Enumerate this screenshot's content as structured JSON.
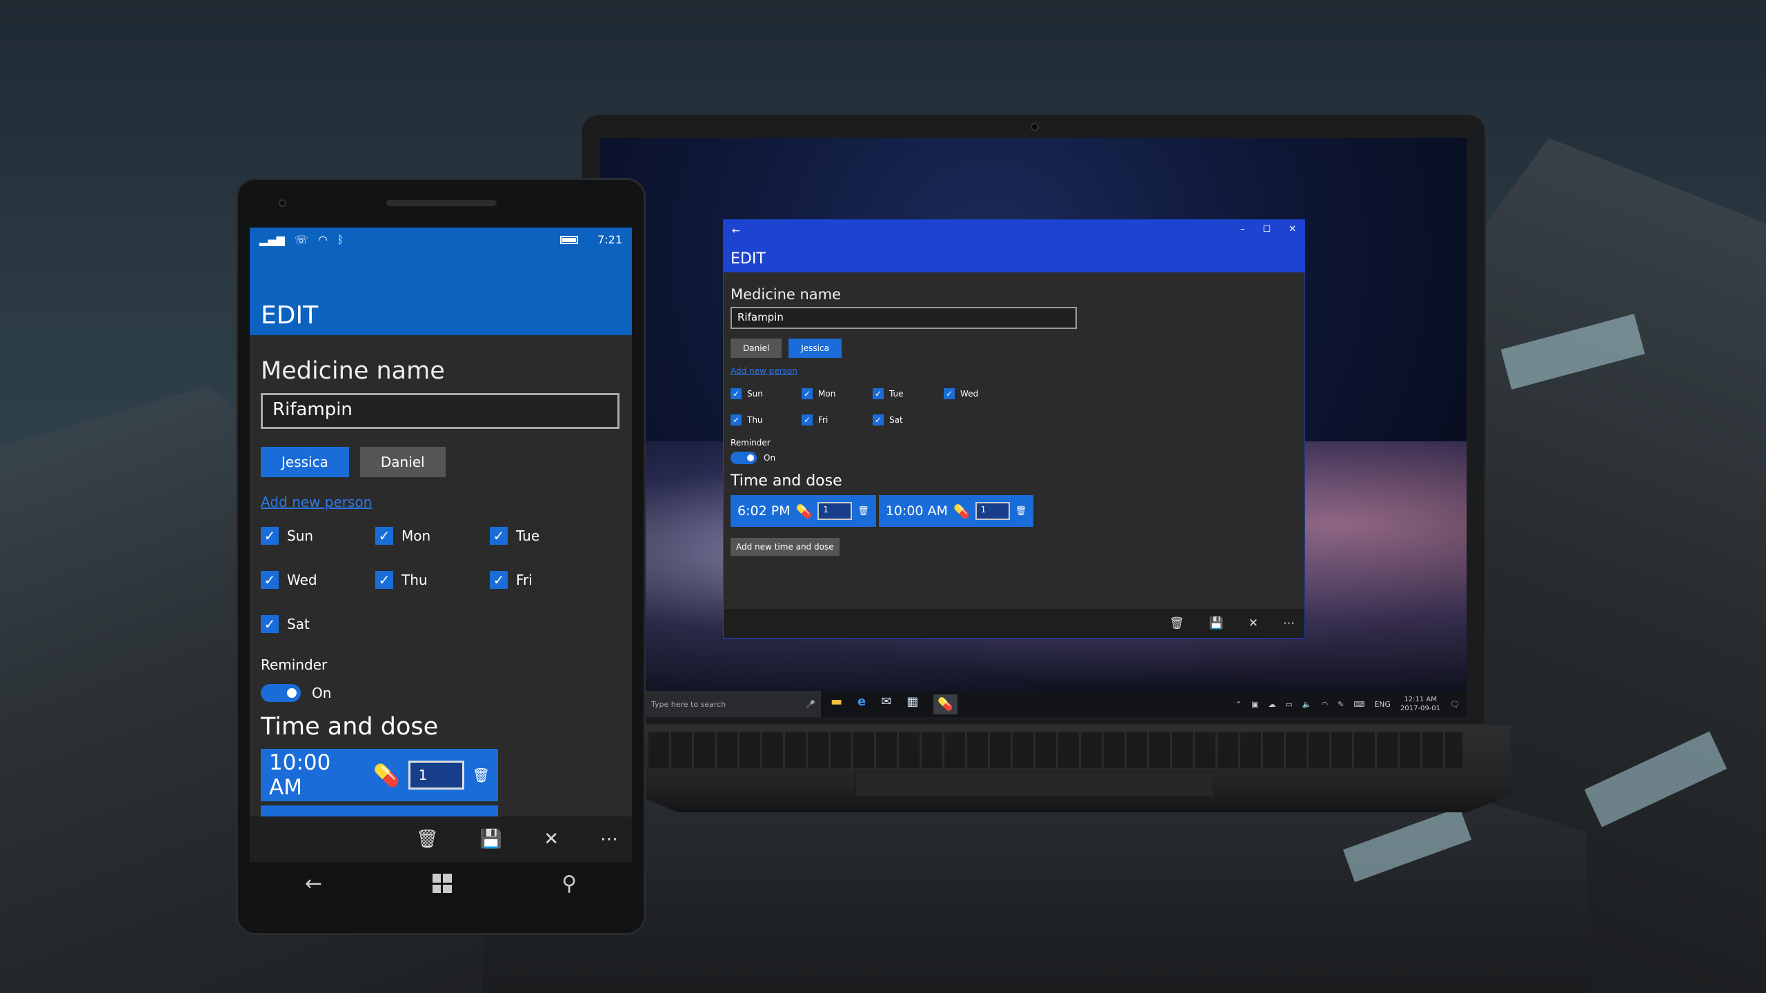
{
  "colors": {
    "accent": "#1a6dd8",
    "phone_header": "#0c62bf",
    "window_header": "#1d44d0"
  },
  "desktop": {
    "window": {
      "back_icon": "back-arrow-icon",
      "title": "EDIT",
      "medicine_label": "Medicine name",
      "medicine_value": "Rifampin",
      "persons": [
        {
          "label": "Daniel",
          "selected": false
        },
        {
          "label": "Jessica",
          "selected": true
        }
      ],
      "add_person": "Add new person",
      "days": [
        "Sun",
        "Mon",
        "Tue",
        "Wed",
        "Thu",
        "Fri",
        "Sat"
      ],
      "reminder_label": "Reminder",
      "reminder_state": "On",
      "time_dose_label": "Time and dose",
      "doses": [
        {
          "time": "6:02 PM",
          "qty": "1"
        },
        {
          "time": "10:00 AM",
          "qty": "1"
        }
      ],
      "add_time_dose": "Add new time and dose"
    },
    "taskbar": {
      "search_placeholder": "Type here to search",
      "lang": "ENG",
      "time": "12:11 AM",
      "date": "2017-09-01"
    }
  },
  "phone": {
    "status": {
      "time": "7:21"
    },
    "title": "EDIT",
    "medicine_label": "Medicine name",
    "medicine_value": "Rifampin",
    "persons": [
      {
        "label": "Jessica",
        "selected": true
      },
      {
        "label": "Daniel",
        "selected": false
      }
    ],
    "add_person": "Add new person",
    "days": [
      "Sun",
      "Mon",
      "Tue",
      "Wed",
      "Thu",
      "Fri",
      "Sat"
    ],
    "reminder_label": "Reminder",
    "reminder_state": "On",
    "time_dose_label": "Time and dose",
    "dose": {
      "time": "10:00 AM",
      "qty": "1"
    }
  }
}
